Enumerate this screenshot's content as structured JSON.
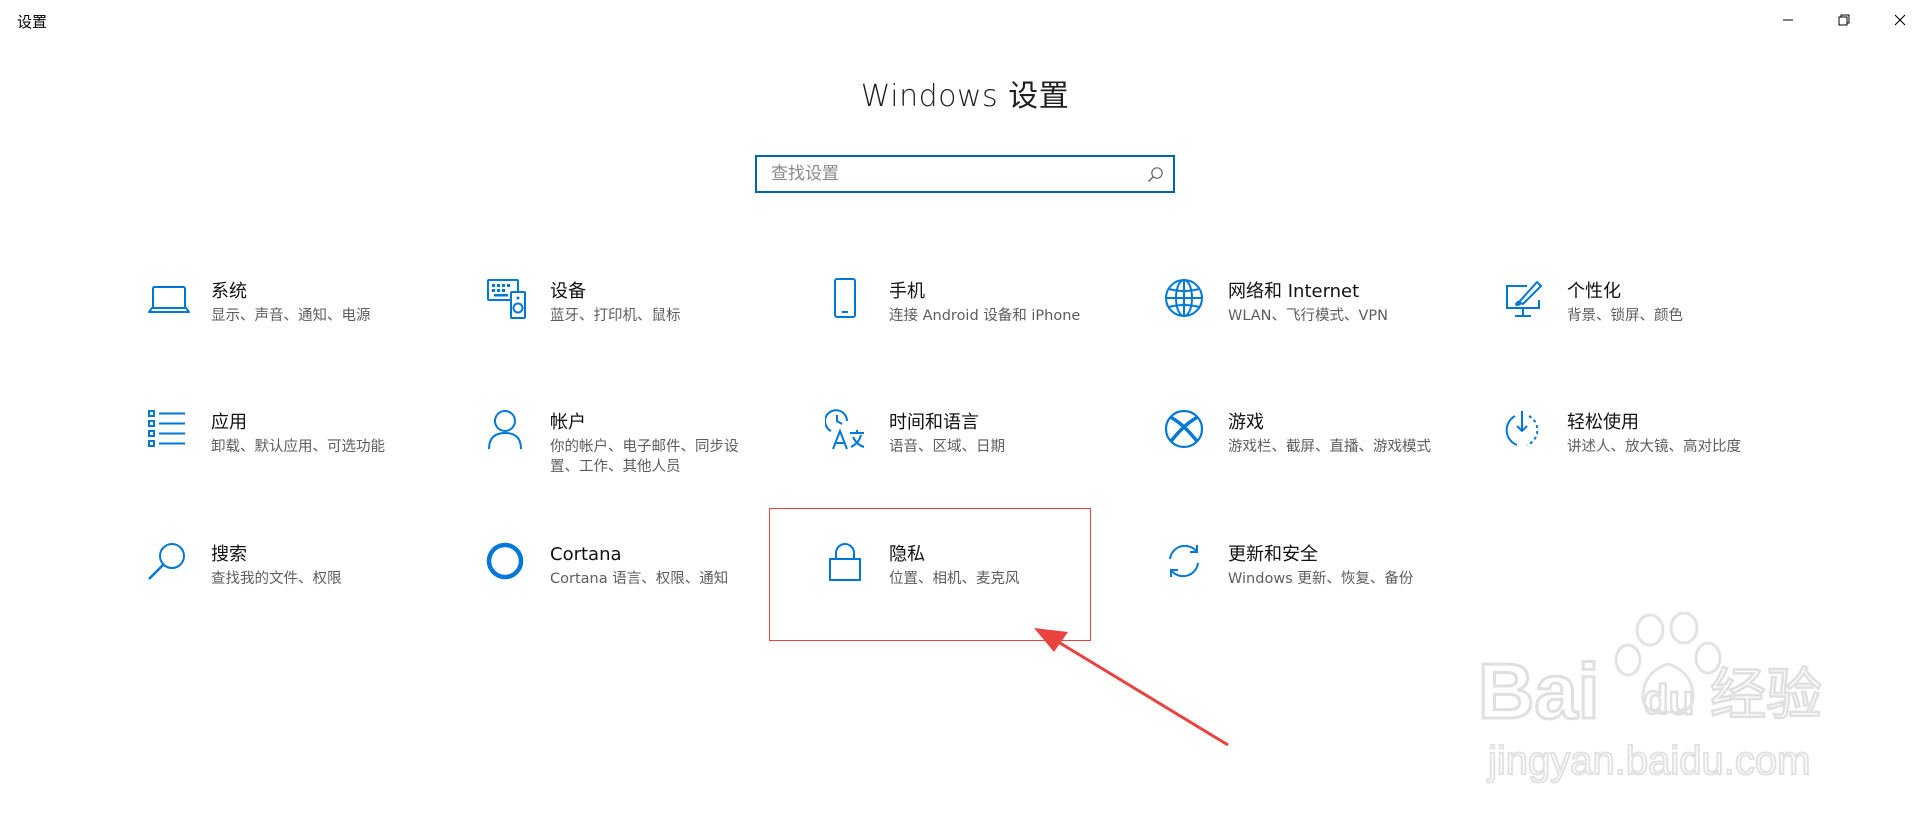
{
  "window": {
    "title": "设置"
  },
  "header": {
    "title": "Windows 设置"
  },
  "search": {
    "placeholder": "查找设置",
    "value": ""
  },
  "tiles": [
    {
      "label": "系统",
      "desc": "显示、声音、通知、电源",
      "icon": "laptop-icon"
    },
    {
      "label": "设备",
      "desc": "蓝牙、打印机、鼠标",
      "icon": "devices-icon"
    },
    {
      "label": "手机",
      "desc": "连接 Android 设备和 iPhone",
      "icon": "phone-icon"
    },
    {
      "label": "网络和 Internet",
      "desc": "WLAN、飞行模式、VPN",
      "icon": "globe-icon"
    },
    {
      "label": "个性化",
      "desc": "背景、锁屏、颜色",
      "icon": "personalization-icon"
    },
    {
      "label": "应用",
      "desc": "卸载、默认应用、可选功能",
      "icon": "apps-list-icon"
    },
    {
      "label": "帐户",
      "desc": "你的帐户、电子邮件、同步设置、工作、其他人员",
      "icon": "person-icon"
    },
    {
      "label": "时间和语言",
      "desc": "语音、区域、日期",
      "icon": "time-language-icon"
    },
    {
      "label": "游戏",
      "desc": "游戏栏、截屏、直播、游戏模式",
      "icon": "xbox-icon"
    },
    {
      "label": "轻松使用",
      "desc": "讲述人、放大镜、高对比度",
      "icon": "ease-of-access-icon"
    },
    {
      "label": "搜索",
      "desc": "查找我的文件、权限",
      "icon": "search-magnifier-icon"
    },
    {
      "label": "Cortana",
      "desc": "Cortana 语言、权限、通知",
      "icon": "cortana-ring-icon"
    },
    {
      "label": "隐私",
      "desc": "位置、相机、麦克风",
      "icon": "lock-icon"
    },
    {
      "label": "更新和安全",
      "desc": "Windows 更新、恢复、备份",
      "icon": "update-sync-icon"
    }
  ],
  "watermark": {
    "brand": "Bai",
    "brand2": "du",
    "suffix": "经验",
    "url": "jingyan.baidu.com"
  },
  "colors": {
    "accent": "#0063b1",
    "icon_blue": "#0078d7",
    "annotation_red": "#e8433f"
  }
}
